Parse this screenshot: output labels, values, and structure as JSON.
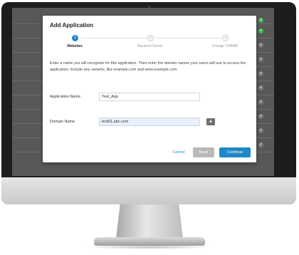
{
  "modal": {
    "title": "Add Application",
    "steps": [
      {
        "number": "1",
        "label": "Websites",
        "active": true
      },
      {
        "number": "2",
        "label": "Backend Server",
        "active": false
      },
      {
        "number": "3",
        "label": "Change CNAME",
        "active": false
      }
    ],
    "intro": "Enter a name you will recognize for this application. Then enter the domain names your users will use to access the application. Include any variants, like example.com and www.example.com.",
    "application_name": {
      "label": "Application Name",
      "value": "Test_App"
    },
    "domain_name": {
      "label": "Domain Name",
      "value": "test01.abc.com"
    },
    "add_domain_symbol": "+",
    "buttons": {
      "cancel": "Cancel",
      "back": "Back",
      "continue": "Continue"
    }
  },
  "colors": {
    "accent": "#1e88c8",
    "back_button_disabled": "#b9b9b9",
    "backdrop": "#585858",
    "status_check": "#3fb950"
  },
  "icons": {
    "step_active": "filled-circle",
    "step_inactive": "outlined-circle",
    "add_domain": "plus-icon",
    "status": "check-circle-icon"
  }
}
